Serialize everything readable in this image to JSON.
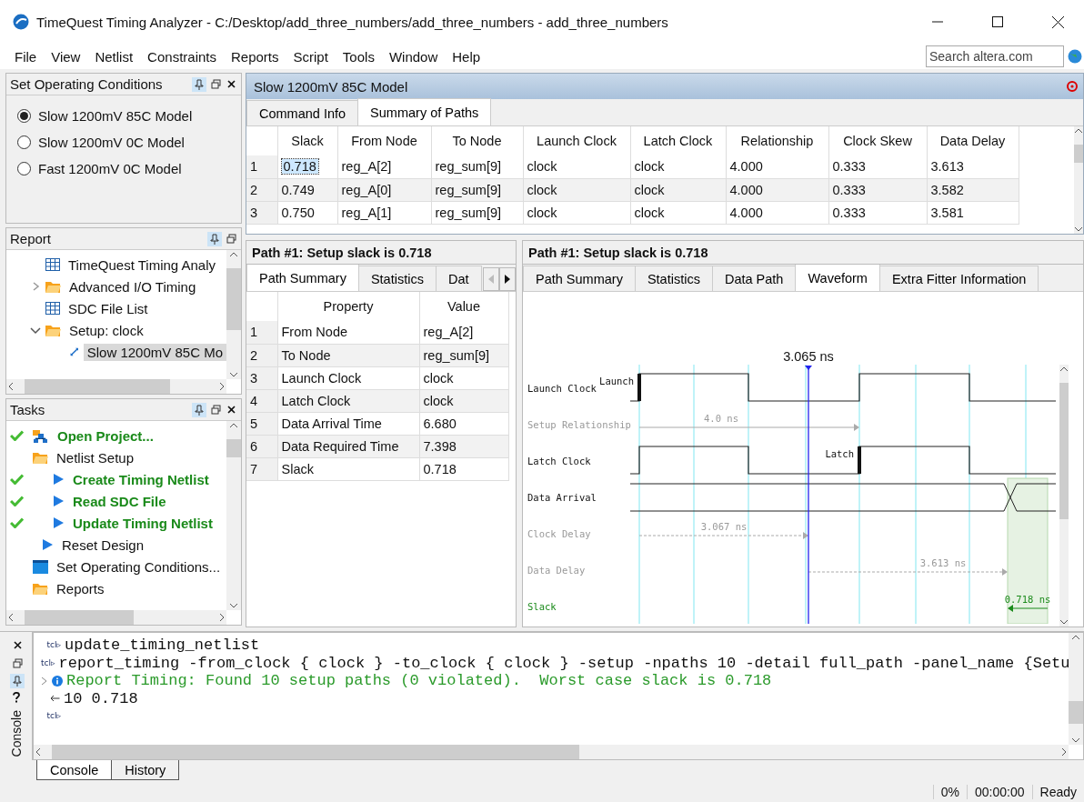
{
  "window": {
    "title": "TimeQuest Timing Analyzer - C:/Desktop/add_three_numbers/add_three_numbers - add_three_numbers"
  },
  "menu": [
    "File",
    "View",
    "Netlist",
    "Constraints",
    "Reports",
    "Script",
    "Tools",
    "Window",
    "Help"
  ],
  "search": {
    "placeholder": "Search altera.com"
  },
  "operating_conditions": {
    "title": "Set Operating Conditions",
    "options": [
      {
        "label": "Slow 1200mV 85C Model",
        "selected": true
      },
      {
        "label": "Slow 1200mV 0C Model",
        "selected": false
      },
      {
        "label": "Fast 1200mV 0C Model",
        "selected": false
      }
    ]
  },
  "report": {
    "title": "Report",
    "items": [
      {
        "label": "TimeQuest Timing Analy",
        "kind": "table",
        "selected": false
      },
      {
        "label": "Advanced I/O Timing",
        "kind": "folder",
        "expanded": false,
        "selected": false
      },
      {
        "label": "SDC File List",
        "kind": "table",
        "selected": false
      },
      {
        "label": "Setup: clock",
        "kind": "folder",
        "expanded": true,
        "selected": false,
        "children": [
          {
            "label": "Slow 1200mV 85C Mo",
            "kind": "path",
            "selected": true
          }
        ]
      }
    ]
  },
  "tasks": {
    "title": "Tasks",
    "items": [
      {
        "label": "Open Project...",
        "kind": "project",
        "done": true
      },
      {
        "label": "Netlist Setup",
        "kind": "folder",
        "done": false,
        "children": [
          {
            "label": "Create Timing Netlist",
            "kind": "run",
            "done": true
          },
          {
            "label": "Read SDC File",
            "kind": "run",
            "done": true
          },
          {
            "label": "Update Timing Netlist",
            "kind": "run",
            "done": true
          }
        ]
      },
      {
        "label": "Reset Design",
        "kind": "run",
        "done": false
      },
      {
        "label": "Set Operating Conditions...",
        "kind": "window",
        "done": false
      },
      {
        "label": "Reports",
        "kind": "folder",
        "done": false
      }
    ]
  },
  "model_panel": {
    "title": "Slow 1200mV 85C Model",
    "tabs": [
      {
        "label": "Command Info",
        "selected": false
      },
      {
        "label": "Summary of Paths",
        "selected": true
      }
    ],
    "table": {
      "columns": [
        "Slack",
        "From Node",
        "To Node",
        "Launch Clock",
        "Latch Clock",
        "Relationship",
        "Clock Skew",
        "Data Delay"
      ],
      "rows": [
        {
          "index": "1",
          "selected": true,
          "cells": [
            "0.718",
            "reg_A[2]",
            "reg_sum[9]",
            "clock",
            "clock",
            "4.000",
            "0.333",
            "3.613"
          ]
        },
        {
          "index": "2",
          "selected": false,
          "cells": [
            "0.749",
            "reg_A[0]",
            "reg_sum[9]",
            "clock",
            "clock",
            "4.000",
            "0.333",
            "3.582"
          ]
        },
        {
          "index": "3",
          "selected": false,
          "cells": [
            "0.750",
            "reg_A[1]",
            "reg_sum[9]",
            "clock",
            "clock",
            "4.000",
            "0.333",
            "3.581"
          ]
        }
      ]
    }
  },
  "path_left": {
    "title": "Path #1: Setup slack is 0.718",
    "tabs": [
      {
        "label": "Path Summary",
        "selected": true
      },
      {
        "label": "Statistics",
        "selected": false
      },
      {
        "label": "Dat",
        "selected": false
      }
    ],
    "table": {
      "columns": [
        "Property",
        "Value"
      ],
      "rows": [
        {
          "index": "1",
          "cells": [
            "From Node",
            "reg_A[2]"
          ]
        },
        {
          "index": "2",
          "cells": [
            "To Node",
            "reg_sum[9]"
          ]
        },
        {
          "index": "3",
          "cells": [
            "Launch Clock",
            "clock"
          ]
        },
        {
          "index": "4",
          "cells": [
            "Latch Clock",
            "clock"
          ]
        },
        {
          "index": "5",
          "cells": [
            "Data Arrival Time",
            "6.680"
          ]
        },
        {
          "index": "6",
          "cells": [
            "Data Required Time",
            "7.398"
          ]
        },
        {
          "index": "7",
          "cells": [
            "Slack",
            "0.718"
          ]
        }
      ]
    }
  },
  "path_right": {
    "title": "Path #1: Setup slack is 0.718",
    "tabs": [
      {
        "label": "Path Summary",
        "selected": false
      },
      {
        "label": "Statistics",
        "selected": false
      },
      {
        "label": "Data Path",
        "selected": false
      },
      {
        "label": "Waveform",
        "selected": true
      },
      {
        "label": "Extra Fitter Information",
        "selected": false
      }
    ],
    "waveform": {
      "cursor_label": "3.065 ns",
      "rows": [
        {
          "label": "Launch Clock",
          "kind": "clock",
          "marker": "Launch"
        },
        {
          "label": "Setup Relationship",
          "kind": "measure",
          "value": "4.0 ns"
        },
        {
          "label": "Latch Clock",
          "kind": "clock",
          "marker": "Latch"
        },
        {
          "label": "Data Arrival",
          "kind": "data"
        },
        {
          "label": "Clock Delay",
          "kind": "measure",
          "value": "3.067 ns"
        },
        {
          "label": "Data Delay",
          "kind": "measure",
          "value": "3.613 ns"
        },
        {
          "label": "Slack",
          "kind": "slack",
          "value": "0.718 ns"
        }
      ]
    }
  },
  "console": {
    "lines": [
      {
        "kind": "command",
        "prefix": "tcl▹",
        "text": "update_timing_netlist"
      },
      {
        "kind": "command",
        "prefix": "tcl▹",
        "text": "report_timing -from_clock { clock } -to_clock { clock } -setup -npaths 10 -detail full_path -panel_name {Setu"
      },
      {
        "kind": "info",
        "text": "Report Timing: Found 10 setup paths (0 violated).  Worst case slack is 0.718"
      },
      {
        "kind": "result",
        "text": "10 0.718"
      },
      {
        "kind": "prompt",
        "prefix": "tcl▹"
      }
    ],
    "side_label": "Console",
    "tabs": [
      {
        "label": "Console",
        "selected": true
      },
      {
        "label": "History",
        "selected": false
      }
    ]
  },
  "status_bar": {
    "progress": "0%",
    "elapsed": "00:00:00",
    "state": "Ready"
  }
}
